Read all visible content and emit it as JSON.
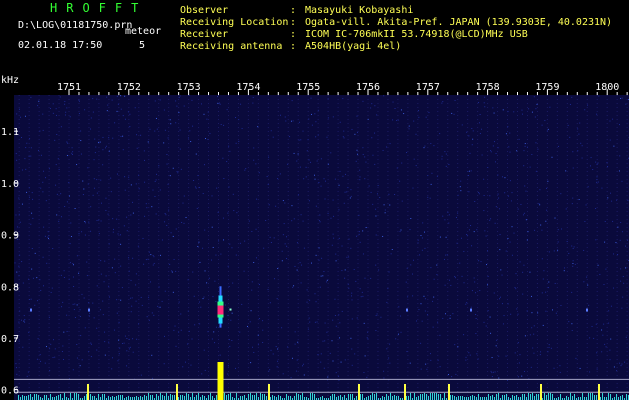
{
  "header": {
    "app_title": "HROFFT",
    "file_path": "D:\\LOG\\01181750.prn",
    "meteor_label": "meteor",
    "timestamp": "02.01.18 17:50",
    "meteor_count": "5"
  },
  "info": [
    {
      "label": "Observer",
      "value": "Masayuki Kobayashi"
    },
    {
      "label": "Receiving Location",
      "value": "Ogata-vill. Akita-Pref. JAPAN (139.9303E, 40.0231N)"
    },
    {
      "label": "Receiver",
      "value": "ICOM IC-706mkII 53.74918(@LCD)MHz USB"
    },
    {
      "label": "Receiving antenna",
      "value": "A504HB(yagi 4el)"
    }
  ],
  "chart_data": {
    "type": "heatmap",
    "title": "",
    "xlabel": "",
    "ylabel": "kHz",
    "x_ticks": [
      "1751",
      "1752",
      "1753",
      "1754",
      "1755",
      "1756",
      "1757",
      "1758",
      "1759",
      "1800"
    ],
    "y_ticks": [
      "1.1",
      "1.0",
      "0.9",
      "0.8",
      "0.7",
      "0.6"
    ],
    "ylim": [
      0.58,
      1.17
    ],
    "grid": true,
    "background_color": "#0a0a3c",
    "grid_color": "#2a2a8a",
    "events": [
      {
        "name": "meteor",
        "time": "17:53.5",
        "freq_min": 0.72,
        "freq_max": 0.8,
        "peak_freq": 0.755
      }
    ],
    "reference_lines_khz": [
      0.62,
      0.595
    ]
  }
}
